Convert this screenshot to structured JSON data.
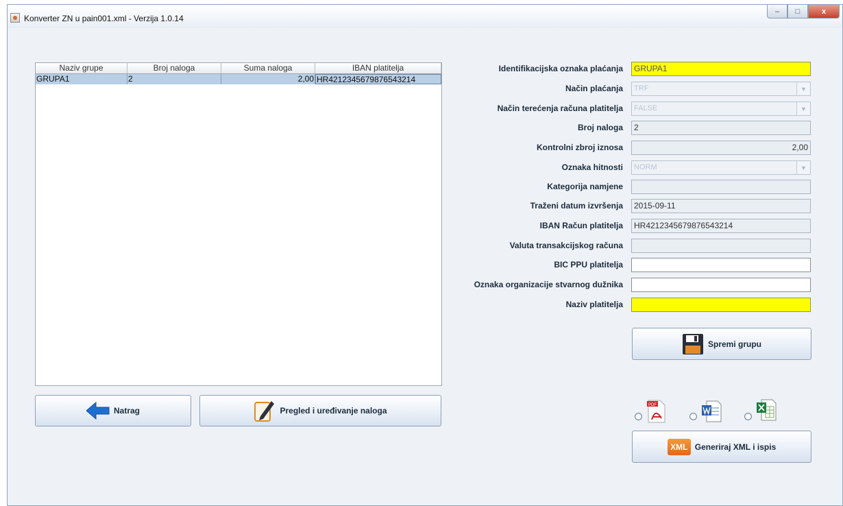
{
  "window": {
    "title": "Konverter ZN u pain001.xml - Verzija 1.0.14",
    "buttons": {
      "minimize": "–",
      "maximize": "□",
      "close": "x"
    }
  },
  "table": {
    "columns": [
      "Naziv grupe",
      "Broj naloga",
      "Suma naloga",
      "IBAN platitelja"
    ],
    "rows": [
      {
        "naziv": "GRUPA1",
        "broj": "2",
        "suma": "2,00",
        "iban": "HR4212345679876543214"
      }
    ]
  },
  "buttons": {
    "back": "Natrag",
    "review": "Pregled i uređivanje naloga",
    "save": "Spremi grupu",
    "generate": "Generiraj XML i ispis",
    "xml_badge": "XML"
  },
  "form": {
    "id_label": "Identifikacijska oznaka plaćanja",
    "id_value": "GRUPA1",
    "method_label": "Način plaćanja",
    "method_value": "TRF",
    "charge_label": "Način terećenja računa platitelja",
    "charge_value": "FALSE",
    "count_label": "Broj naloga",
    "count_value": "2",
    "sum_label": "Kontrolni zbroj iznosa",
    "sum_value": "2,00",
    "urgency_label": "Oznaka hitnosti",
    "urgency_value": "NORM",
    "category_label": "Kategorija namjene",
    "category_value": "",
    "date_label": "Traženi datum izvršenja",
    "date_value": "2015-09-11",
    "iban_label": "IBAN Račun platitelja",
    "iban_value": "HR4212345679876543214",
    "currency_label": "Valuta transakcijskog računa",
    "currency_value": "",
    "bic_label": "BIC PPU platitelja",
    "bic_value": "",
    "org_label": "Oznaka organizacije stvarnog dužnika",
    "org_value": "",
    "payer_label": "Naziv platitelja",
    "payer_value": ""
  },
  "output_formats": {
    "selected": "none",
    "options": [
      "pdf",
      "word",
      "excel"
    ],
    "pdf_badge": "PDF"
  },
  "colors": {
    "required_field": "#ffff00",
    "selection": "#b8cfe5",
    "window_bg": "#eef2f7"
  }
}
